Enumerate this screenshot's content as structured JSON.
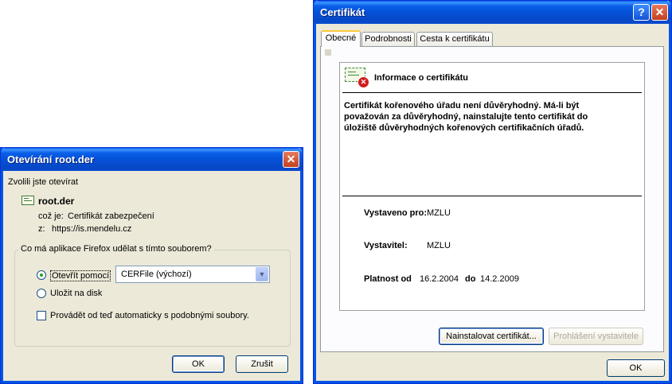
{
  "open_dialog": {
    "title": "Otevírání root.der",
    "intro": "Zvolili jste otevírat",
    "file_name": "root.der",
    "type_label": "což je:",
    "type_value": "Certifikát zabezpečení",
    "from_label": "z:",
    "from_value": "https://is.mendelu.cz",
    "group_label": "Co má aplikace Firefox udělat s tímto souborem?",
    "open_with_label": "Otevřít pomocí",
    "open_with_value": "CERFile (výchozí)",
    "save_label": "Uložit na disk",
    "auto_label": "Provádět od teď automaticky s podobnými soubory.",
    "ok_label": "OK",
    "cancel_label": "Zrušit"
  },
  "cert_dialog": {
    "title": "Certifikát",
    "tabs": [
      "Obecné",
      "Podrobnosti",
      "Cesta k certifikátu"
    ],
    "info_title": "Informace o certifikátu",
    "warning": "Certifikát kořenového úřadu není důvěryhodný. Má-li být považován za důvěryhodný, nainstalujte tento certifikát do úložiště důvěryhodných kořenových certifikačních úřadů.",
    "issued_to_label": "Vystaveno pro:",
    "issued_to_value": "MZLU",
    "issuer_label": "Vystavitel:",
    "issuer_value": "MZLU",
    "validity_label": "Platnost od",
    "validity_from": "16.2.2004",
    "validity_to_label": "do",
    "validity_to": "14.2.2009",
    "install_button": "Nainstalovat certifikát...",
    "statement_button": "Prohlášení vystavitele",
    "ok_label": "OK"
  },
  "colors": {
    "titlebar": "#0a5fe8",
    "window_bg": "#ece9d8",
    "close_button": "#c2401e"
  }
}
